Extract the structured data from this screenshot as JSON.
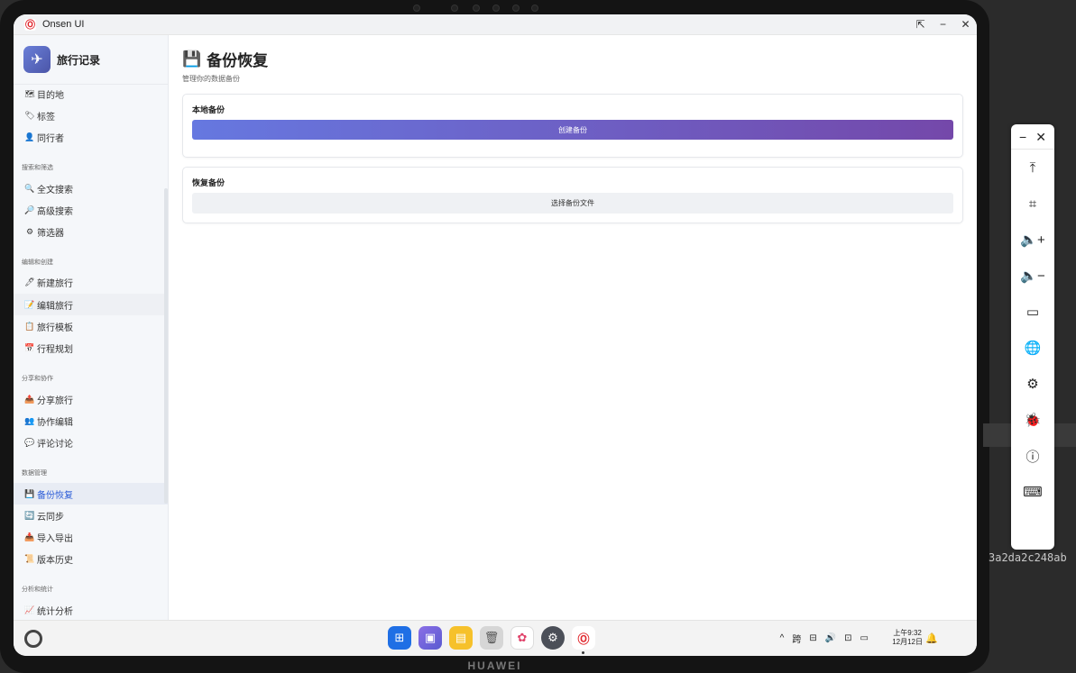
{
  "window": {
    "title": "Onsen UI",
    "controls": [
      "⇱",
      "−",
      "✕"
    ]
  },
  "app": {
    "name": "旅行记录",
    "icon": "✈"
  },
  "sidebar": {
    "items_top": [
      {
        "icon": "🗺",
        "label": "目的地"
      },
      {
        "icon": "🏷",
        "label": "标签"
      },
      {
        "icon": "👤",
        "label": "同行者"
      }
    ],
    "sections": [
      {
        "title": "搜索和筛选",
        "items": [
          {
            "icon": "🔍",
            "label": "全文搜索"
          },
          {
            "icon": "🔎",
            "label": "高级搜索"
          },
          {
            "icon": "⚙",
            "label": "筛选器"
          }
        ]
      },
      {
        "title": "编辑和创建",
        "items": [
          {
            "icon": "🖊",
            "label": "新建旅行"
          },
          {
            "icon": "📝",
            "label": "编辑旅行"
          },
          {
            "icon": "📋",
            "label": "旅行模板"
          },
          {
            "icon": "📅",
            "label": "行程规划"
          }
        ]
      },
      {
        "title": "分享和协作",
        "items": [
          {
            "icon": "📤",
            "label": "分享旅行"
          },
          {
            "icon": "👥",
            "label": "协作编辑"
          },
          {
            "icon": "💬",
            "label": "评论讨论"
          }
        ]
      },
      {
        "title": "数据管理",
        "items": [
          {
            "icon": "💾",
            "label": "备份恢复"
          },
          {
            "icon": "🔄",
            "label": "云同步"
          },
          {
            "icon": "📥",
            "label": "导入导出"
          },
          {
            "icon": "📜",
            "label": "版本历史"
          }
        ]
      },
      {
        "title": "分析和统计",
        "items": [
          {
            "icon": "📈",
            "label": "统计分析"
          }
        ]
      }
    ]
  },
  "main": {
    "icon": "💾",
    "title": "备份恢复",
    "subtitle": "管理你的数据备份",
    "local_card": {
      "title": "本地备份",
      "button": "创建备份"
    },
    "restore_card": {
      "title": "恢复备份",
      "button": "选择备份文件"
    }
  },
  "taskbar": {
    "dock": [
      "⊞",
      "▣",
      "▤",
      "🗑",
      "✿",
      "⚙",
      "Ⓞ"
    ],
    "tray": [
      "^",
      "跨",
      "⊟",
      "🔊",
      "⊡",
      "▭"
    ],
    "time": "上午9:32",
    "date": "12月12日",
    "bell": "🔔"
  },
  "float_toolbar": {
    "header": [
      "−",
      "✕"
    ],
    "tools": [
      "⤒",
      "⌗",
      "🔈+",
      "🔈−",
      "▭",
      "🌐",
      "⚙",
      "🐞",
      "ⓘ",
      "⌨"
    ]
  },
  "device": {
    "brand": "HUAWEI"
  },
  "overlay_text": "3a2da2c248ab",
  "colors": {
    "accent_start": "#6678e0",
    "accent_end": "#7448aa",
    "active": "#2a5bd7"
  }
}
